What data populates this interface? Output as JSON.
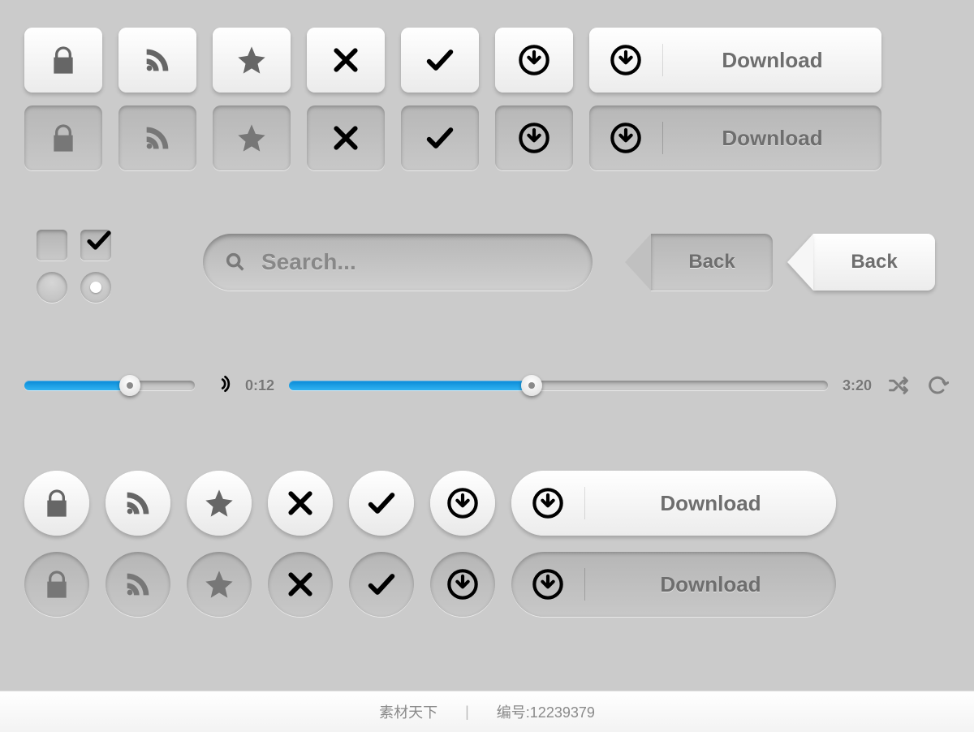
{
  "buttons": {
    "icons": [
      "lock",
      "rss",
      "star",
      "close",
      "check",
      "download-arrow"
    ],
    "download_label": "Download"
  },
  "checkboxes": {
    "unchecked": false,
    "checked": true
  },
  "radios": {
    "unselected": false,
    "selected": true
  },
  "search": {
    "placeholder": "Search..."
  },
  "back": {
    "label": "Back"
  },
  "player": {
    "volume_percent": 62,
    "elapsed": "0:12",
    "total": "3:20",
    "progress_percent": 45
  },
  "footer": {
    "left_label": "素材天下",
    "item_prefix": "编号",
    "item_id": "12239379"
  },
  "colors": {
    "accent": "#1a9ee5"
  }
}
